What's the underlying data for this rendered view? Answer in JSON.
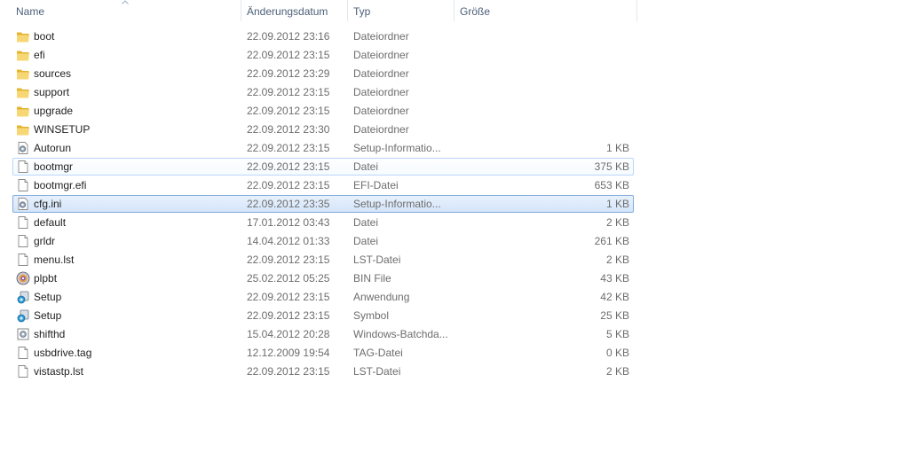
{
  "columns": {
    "name": "Name",
    "date": "Änderungsdatum",
    "type": "Typ",
    "size": "Größe"
  },
  "files": [
    {
      "name": "boot",
      "date": "22.09.2012 23:16",
      "type": "Dateiordner",
      "size": "",
      "icon": "folder-icon"
    },
    {
      "name": "efi",
      "date": "22.09.2012 23:15",
      "type": "Dateiordner",
      "size": "",
      "icon": "folder-icon"
    },
    {
      "name": "sources",
      "date": "22.09.2012 23:29",
      "type": "Dateiordner",
      "size": "",
      "icon": "folder-icon"
    },
    {
      "name": "support",
      "date": "22.09.2012 23:15",
      "type": "Dateiordner",
      "size": "",
      "icon": "folder-icon"
    },
    {
      "name": "upgrade",
      "date": "22.09.2012 23:15",
      "type": "Dateiordner",
      "size": "",
      "icon": "folder-icon"
    },
    {
      "name": "WINSETUP",
      "date": "22.09.2012 23:30",
      "type": "Dateiordner",
      "size": "",
      "icon": "folder-icon"
    },
    {
      "name": "Autorun",
      "date": "22.09.2012 23:15",
      "type": "Setup-Informatio...",
      "size": "1 KB",
      "icon": "settings-file-icon"
    },
    {
      "name": "bootmgr",
      "date": "22.09.2012 23:15",
      "type": "Datei",
      "size": "375 KB",
      "icon": "file-icon",
      "state": "hover"
    },
    {
      "name": "bootmgr.efi",
      "date": "22.09.2012 23:15",
      "type": "EFI-Datei",
      "size": "653 KB",
      "icon": "file-icon"
    },
    {
      "name": "cfg.ini",
      "date": "22.09.2012 23:35",
      "type": "Setup-Informatio...",
      "size": "1 KB",
      "icon": "settings-file-icon",
      "state": "selected"
    },
    {
      "name": "default",
      "date": "17.01.2012 03:43",
      "type": "Datei",
      "size": "2 KB",
      "icon": "file-icon"
    },
    {
      "name": "grldr",
      "date": "14.04.2012 01:33",
      "type": "Datei",
      "size": "261 KB",
      "icon": "file-icon"
    },
    {
      "name": "menu.lst",
      "date": "22.09.2012 23:15",
      "type": "LST-Datei",
      "size": "2 KB",
      "icon": "file-icon"
    },
    {
      "name": "plpbt",
      "date": "25.02.2012 05:25",
      "type": "BIN File",
      "size": "43 KB",
      "icon": "disc-icon"
    },
    {
      "name": "Setup",
      "date": "22.09.2012 23:15",
      "type": "Anwendung",
      "size": "42 KB",
      "icon": "setup-icon"
    },
    {
      "name": "Setup",
      "date": "22.09.2012 23:15",
      "type": "Symbol",
      "size": "25 KB",
      "icon": "setup-icon"
    },
    {
      "name": "shifthd",
      "date": "15.04.2012 20:28",
      "type": "Windows-Batchda...",
      "size": "5 KB",
      "icon": "batch-file-icon"
    },
    {
      "name": "usbdrive.tag",
      "date": "12.12.2009 19:54",
      "type": "TAG-Datei",
      "size": "0 KB",
      "icon": "file-icon"
    },
    {
      "name": "vistastp.lst",
      "date": "22.09.2012 23:15",
      "type": "LST-Datei",
      "size": "2 KB",
      "icon": "file-icon"
    }
  ]
}
